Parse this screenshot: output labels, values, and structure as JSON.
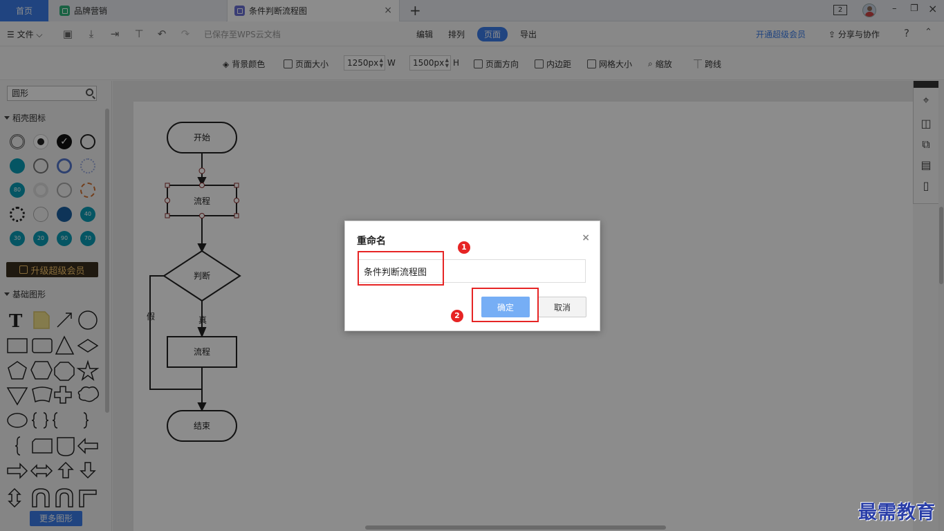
{
  "tabs": {
    "home": "首页",
    "brand": "品牌营销",
    "doc": "条件判断流程图",
    "close": "×",
    "add": "+"
  },
  "window": {
    "badge": "2",
    "minimize": "–",
    "restore": "❐",
    "close": "×"
  },
  "menubar": {
    "file": "☰ 文件 ⌵",
    "saved": "已保存至WPS云文档",
    "tabs": [
      "编辑",
      "排列",
      "页面",
      "导出"
    ],
    "active_tab": "页面",
    "vip": "开通超级会员",
    "share": "分享与协作",
    "help": "?",
    "collapse": "⌃"
  },
  "pagebar": {
    "bg_color": "背景颜色",
    "page_size": "页面大小",
    "width_value": "1250px",
    "width_unit": "W",
    "height_value": "1500px",
    "height_unit": "H",
    "orientation": "页面方向",
    "padding": "内边距",
    "grid_size": "网格大小",
    "zoom": "缩放",
    "jump_line": "跨线"
  },
  "sidebar": {
    "search_value": "圆形",
    "section1": "稻壳图标",
    "vip_button": "升级超级会员",
    "section2": "基础图形",
    "more_shapes": "更多图形",
    "icon_labels": [
      "80",
      "40",
      "30",
      "20",
      "90",
      "70"
    ],
    "text_tool": "T"
  },
  "flowchart": {
    "start": "开始",
    "process1": "流程",
    "decision": "判断",
    "true_label": "真",
    "false_label": "假",
    "process2": "流程",
    "end": "结束"
  },
  "dialog": {
    "title": "重命名",
    "close": "×",
    "input_value": "条件判断流程图",
    "ok": "确定",
    "cancel": "取消",
    "badge1": "1",
    "badge2": "2"
  },
  "watermark": "最需教育",
  "colors": {
    "accent": "#3b7de9",
    "highlight": "#e62424",
    "ok_button": "#76aef5",
    "vip_gold": "#f5c46a"
  }
}
